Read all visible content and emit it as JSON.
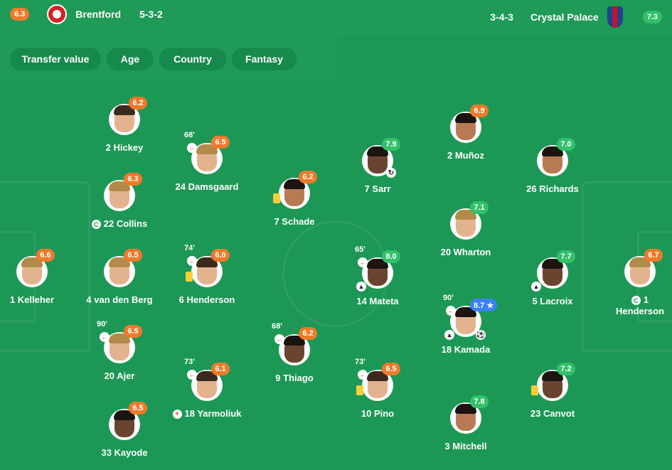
{
  "header": {
    "home": {
      "rating": "6.3",
      "name": "Brentford",
      "formation": "5-3-2",
      "crest_icon": "brentford-crest-icon"
    },
    "away": {
      "formation": "3-4-3",
      "name": "Crystal Palace",
      "rating": "7.3",
      "crest_icon": "crystal-palace-crest-icon"
    }
  },
  "filters": [
    {
      "label": "Transfer value"
    },
    {
      "label": "Age"
    },
    {
      "label": "Country"
    },
    {
      "label": "Fantasy"
    }
  ],
  "colors": {
    "pitch": "#1d9755",
    "rating_low": "#ef7a2a",
    "rating_high": "#33c06a",
    "motm": "#3b82f6"
  },
  "home_players": [
    {
      "id": "kelleher",
      "name": "1 Kelleher",
      "rating": "6.6"
    },
    {
      "id": "hickey",
      "name": "2 Hickey",
      "rating": "6.2"
    },
    {
      "id": "collins",
      "name": "22 Collins",
      "rating": "6.3",
      "captain": true
    },
    {
      "id": "vandenberg",
      "name": "4 van den Berg",
      "rating": "6.5"
    },
    {
      "id": "ajer",
      "name": "20 Ajer",
      "rating": "6.5",
      "sub_minute": "90'"
    },
    {
      "id": "kayode",
      "name": "33 Kayode",
      "rating": "6.5"
    },
    {
      "id": "damsgaard",
      "name": "24 Damsgaard",
      "rating": "6.5",
      "sub_minute": "68'"
    },
    {
      "id": "henderson_j",
      "name": "6 Henderson",
      "rating": "6.0",
      "sub_minute": "74'",
      "yellow": true
    },
    {
      "id": "yarmoliuk",
      "name": "18 Yarmoliuk",
      "rating": "6.1",
      "sub_minute": "73'",
      "red_event": true
    },
    {
      "id": "schade",
      "name": "7 Schade",
      "rating": "6.2",
      "yellow": true
    },
    {
      "id": "thiago",
      "name": "9 Thiago",
      "rating": "6.2",
      "sub_minute": "68'"
    }
  ],
  "away_players": [
    {
      "id": "henderson_d",
      "name_line1": "1",
      "name_line2": "Henderson",
      "rating": "6.7",
      "captain": true
    },
    {
      "id": "munoz",
      "name": "2 Muñoz",
      "rating": "6.9"
    },
    {
      "id": "richards",
      "name": "26 Richards",
      "rating": "7.0"
    },
    {
      "id": "wharton",
      "name": "20 Wharton",
      "rating": "7.1"
    },
    {
      "id": "sarr",
      "name": "7 Sarr",
      "rating": "7.9"
    },
    {
      "id": "mateta",
      "name": "14 Mateta",
      "rating": "8.0",
      "sub_minute": "65'"
    },
    {
      "id": "lacroix",
      "name": "5 Lacroix",
      "rating": "7.7"
    },
    {
      "id": "kamada",
      "name": "18 Kamada",
      "rating": "8.7 ★",
      "sub_minute": "90'"
    },
    {
      "id": "pino",
      "name": "10 Pino",
      "rating": "6.5",
      "sub_minute": "73'",
      "yellow": true
    },
    {
      "id": "canvot",
      "name": "23 Canvot",
      "rating": "7.2",
      "yellow": true
    },
    {
      "id": "mitchell",
      "name": "3 Mitchell",
      "rating": "7.8"
    }
  ]
}
